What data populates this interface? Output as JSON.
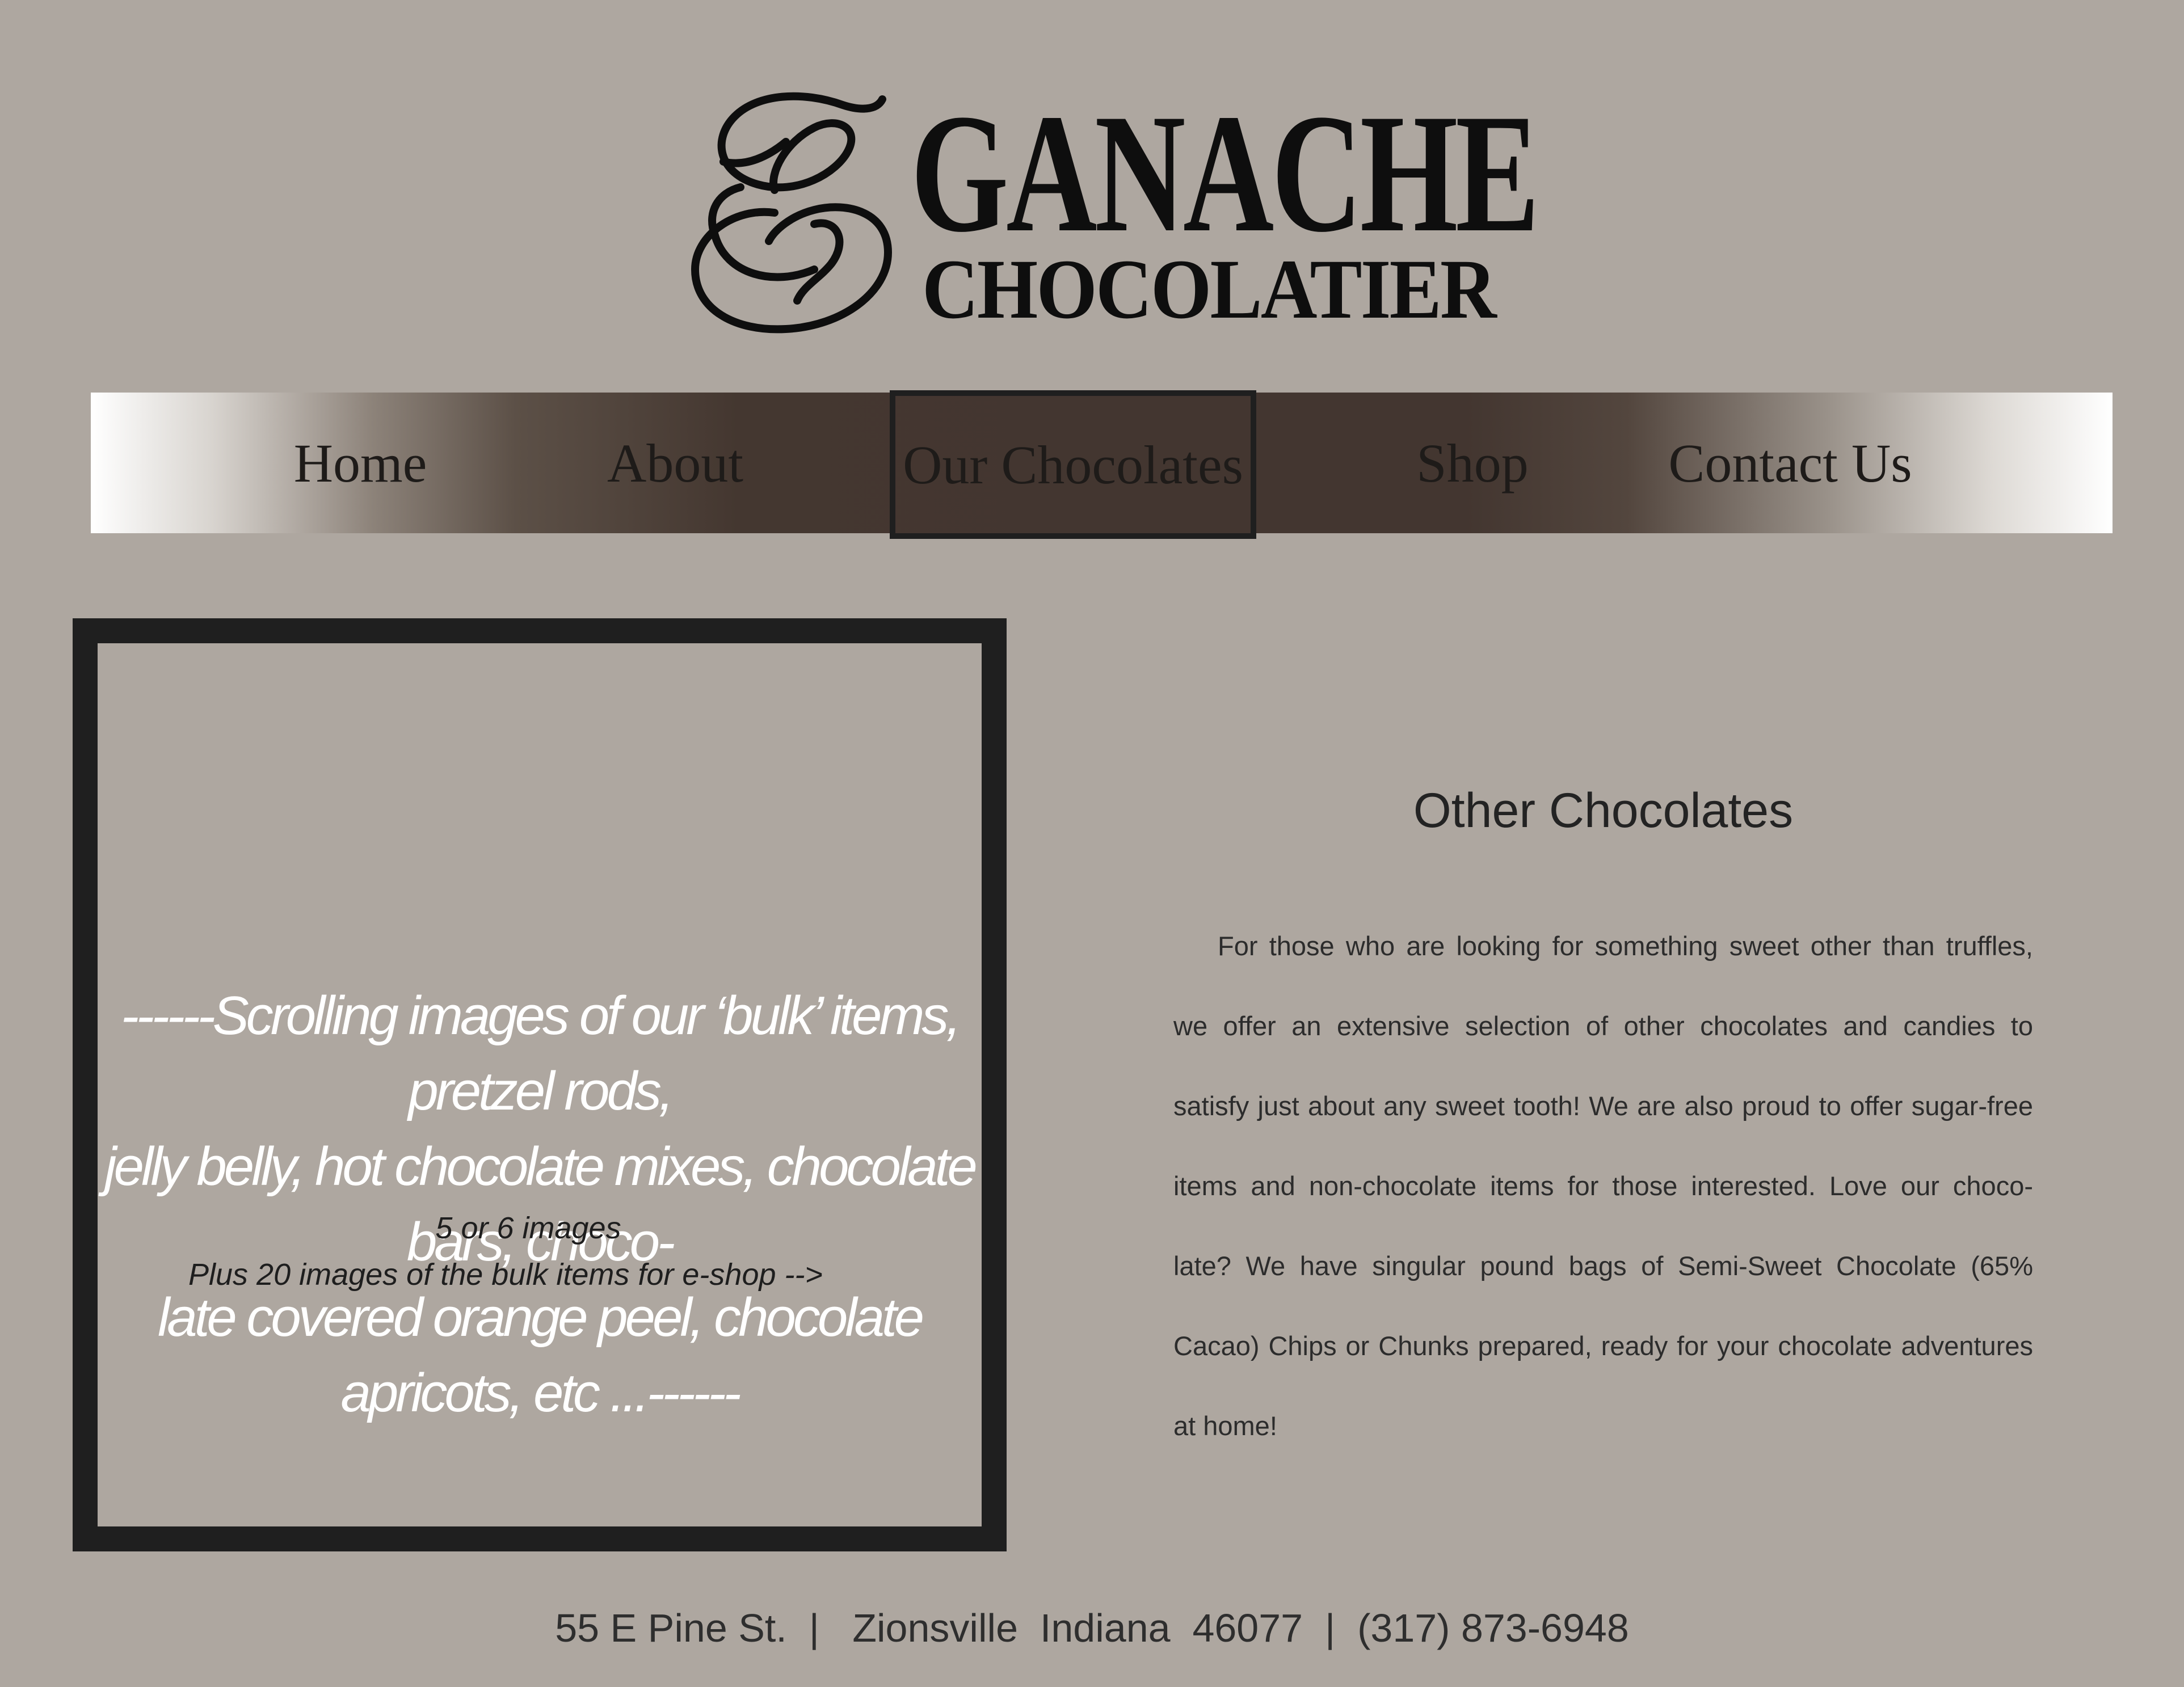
{
  "brand": {
    "name": "GANACHE",
    "tagline": "CHOCOLATIER"
  },
  "nav": {
    "items": [
      {
        "label": "Home"
      },
      {
        "label": "About"
      },
      {
        "label": "Our Chocolates"
      },
      {
        "label": "Shop"
      },
      {
        "label": "Contact Us"
      }
    ],
    "active": "Our Chocolates"
  },
  "image_placeholder": {
    "lines": [
      "------Scrolling images of our ‘bulk’ items, pretzel rods,",
      "jelly belly, hot chocolate mixes, chocolate bars, choco-",
      "late covered orange peel, chocolate apricots, etc ...------"
    ],
    "note_line_1": "5 or 6 images",
    "note_line_2": "Plus 20 images of the bulk items for e-shop -->"
  },
  "section": {
    "title": "Other Chocolates",
    "body": "For those who are looking for something sweet other than truffles, we offer an extensive selection of other chocolates and candies to satisfy just about any sweet tooth! We are also proud to offer sugar-free items and non-chocolate items for those interested. Love our choco-late? We have singular pound bags of  Semi-Sweet Chocolate (65% Cacao) Chips or Chunks prepared, ready for your chocolate adventures at home!"
  },
  "footer": {
    "address": "55 E Pine St.  |   Zionsville  Indiana  46077  |  (317) 873-6948"
  },
  "colors": {
    "background": "#aea7a0",
    "nav_dark": "#433630",
    "frame": "#1f1f1f",
    "placeholder_text": "#ffffff"
  }
}
